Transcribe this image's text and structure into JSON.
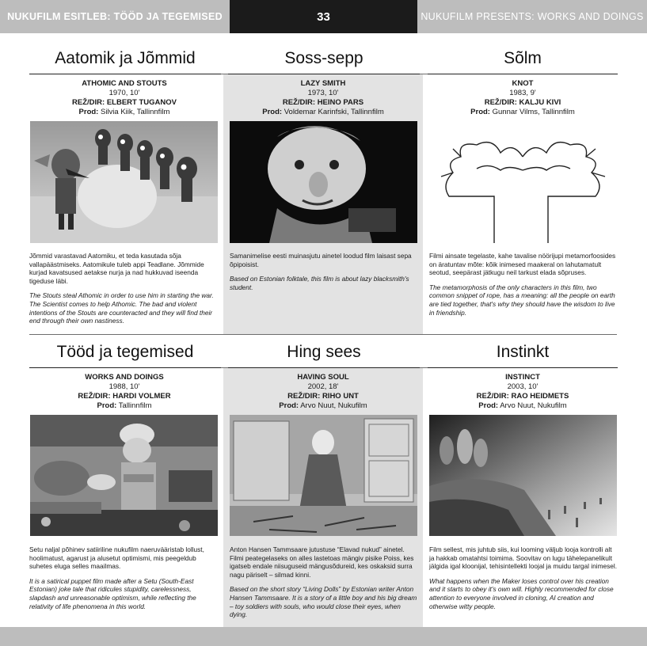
{
  "header": {
    "left": "NUKUFILM ESITLEB: TÖÖD JA TEGEMISED",
    "page_number": "33",
    "right": "NUKUFILM PRESENTS: WORKS AND DOINGS"
  },
  "films": [
    {
      "title": "Aatomik ja Jõmmid",
      "en_title": "ATHOMIC AND STOUTS",
      "year": "1970, 10'",
      "director": "REŽ/DIR: ELBERT TUGANOV",
      "prod_label": "Prod:",
      "prod": "Silvia Kiik, Tallinnfilm",
      "text_et": "Jõmmid varastavad Aatomiku, et teda kasutada sõja vallapäästmiseks. Aatomikule tuleb appi Teadlane. Jõmmide kurjad kavatsused aetakse nurja ja nad hukkuvad iseenda tigeduse läbi.",
      "text_en": "The Stouts steal Athomic in order to use him in starting the war. The Scientist comes to help Athomic. The bad and violent intentions of the Stouts are counteracted and they will find their end through their own nastiness."
    },
    {
      "title": "Soss-sepp",
      "en_title": "LAZY SMITH",
      "year": "1973, 10'",
      "director": "REŽ/DIR: HEINO PARS",
      "prod_label": "Prod:",
      "prod": "Voldemar Karinfski, Tallinnfilm",
      "text_et": "Samanimelise eesti muinasjutu ainetel loodud film laisast sepa õpipoisist.",
      "text_en": "Based on Estonian folktale, this film is about lazy blacksmith's student."
    },
    {
      "title": "Sõlm",
      "en_title": "KNOT",
      "year": "1983, 9'",
      "director": "REŽ/DIR: KALJU KIVI",
      "prod_label": "Prod:",
      "prod": "Gunnar Vilms, Tallinnfilm",
      "text_et": "Filmi ainsate tegelaste, kahe tavalise nöörijupi metamorfoosides on äratuntav mõte: kõik inimesed maakeral on lahutamatult seotud, seepärast jätkugu neil tarkust elada sõpruses.",
      "text_en": "The metamorphosis of the only characters in this film, two common snippet of rope, has a meaning: all the people on earth are tied together, that's why they should have the wisdom to live in friendship."
    },
    {
      "title": "Tööd ja tegemised",
      "en_title": "WORKS AND DOINGS",
      "year": "1988, 10'",
      "director": "REŽ/DIR: HARDI VOLMER",
      "prod_label": "Prod:",
      "prod": "Tallinnfilm",
      "text_et": "Setu naljal põhinev satiiriline nukufilm naeruvääristab lollust, hoolimatust, agarust ja alusetut optimismi, mis peegeldub suhetes eluga selles maailmas.",
      "text_en": "It is a satirical puppet film made after a Setu (South-East Estonian) joke tale that ridicules stupidity, carelessness, slapdash and unreasonable optimism, while reflecting the relativity of life phenomena in this world."
    },
    {
      "title": "Hing sees",
      "en_title": "HAVING SOUL",
      "year": "2002, 18'",
      "director": "REŽ/DIR: RIHO UNT",
      "prod_label": "Prod:",
      "prod": "Arvo Nuut, Nukufilm",
      "text_et": "Anton Hansen Tammsaare jutustuse “Elavad nukud” ainetel. Filmi peategelaseks on alles lastetoas mängiv pisike Poiss, kes igatseb endale niisuguseid mängusõdureid, kes oskaksid surra nagu päriselt – silmad kinni.",
      "text_en": "Based on the short story “Living Dolls” by Estonian writer Anton Hansen Tammsaare. It is a story of a little boy and his big dream – toy soldiers with souls, who would close their eyes, when dying."
    },
    {
      "title": "Instinkt",
      "en_title": "INSTINCT",
      "year": "2003, 10'",
      "director": "REŽ/DIR: RAO HEIDMETS",
      "prod_label": "Prod:",
      "prod": "Arvo Nuut, Nukufilm",
      "text_et": "Film sellest, mis juhtub siis, kui looming väljub looja kontrolli alt ja hakkab omatahtsi toimima. Soovitav on lugu tähelepanelikult jälgida igal kloonijal, tehisintellekti loojal ja muidu targal inimesel.",
      "text_en": "What happens when the Maker loses control over his creation and it starts to obey it's own will. Highly recommended for close attention to everyone involved in cloning, AI creation and otherwise witty people."
    }
  ]
}
